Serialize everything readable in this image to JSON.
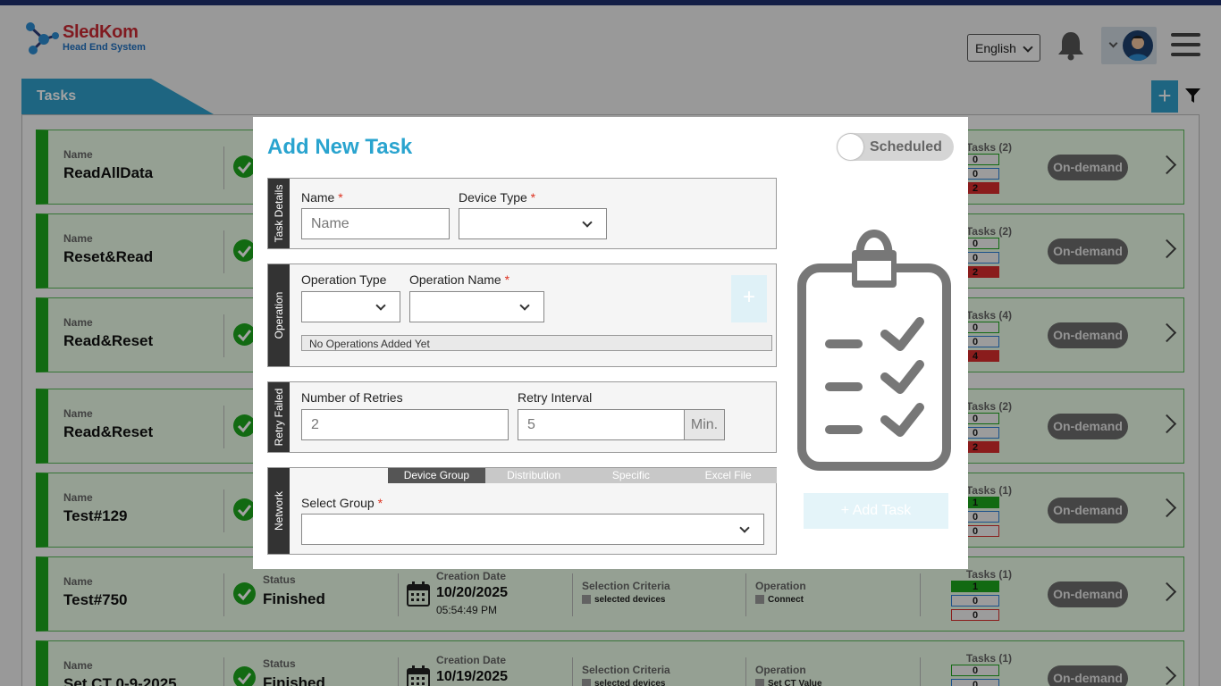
{
  "header": {
    "logo_title": "SledKom",
    "logo_subtitle": "Head End System",
    "language": "English"
  },
  "page": {
    "tab_title": "Tasks",
    "add_label": "+"
  },
  "labels": {
    "name": "Name",
    "status": "Status",
    "creation_date": "Creation Date",
    "selection_criteria": "Selection Criteria",
    "operation": "Operation"
  },
  "tasks": [
    {
      "name": "ReadAllData",
      "status": "",
      "date": "",
      "time": "",
      "selection": "",
      "operation": "",
      "tasks_label": "Tasks (2)",
      "ok": "0",
      "pending": "0",
      "failed": "2",
      "ok_fill": false,
      "fail_fill": true,
      "mode": "On-demand"
    },
    {
      "name": "Reset&Read",
      "status": "",
      "date": "",
      "time": "",
      "selection": "",
      "operation": "",
      "tasks_label": "Tasks (2)",
      "ok": "0",
      "pending": "0",
      "failed": "2",
      "ok_fill": false,
      "fail_fill": true,
      "mode": "On-demand"
    },
    {
      "name": "Read&Reset",
      "status": "",
      "date": "",
      "time": "",
      "selection": "",
      "operation": "",
      "tasks_label": "Tasks (4)",
      "ok": "0",
      "pending": "0",
      "failed": "4",
      "ok_fill": false,
      "fail_fill": true,
      "mode": "On-demand"
    },
    {
      "name": "Read&Reset",
      "status": "",
      "date": "",
      "time": "",
      "selection": "",
      "operation": "",
      "tasks_label": "Tasks (2)",
      "ok": "0",
      "pending": "0",
      "failed": "2",
      "ok_fill": false,
      "fail_fill": true,
      "mode": "On-demand"
    },
    {
      "name": "Test#129",
      "status": "",
      "date": "",
      "time": "",
      "selection": "",
      "operation": "",
      "tasks_label": "Tasks (1)",
      "ok": "1",
      "pending": "0",
      "failed": "0",
      "ok_fill": true,
      "fail_fill": false,
      "mode": "On-demand"
    },
    {
      "name": "Test#750",
      "status": "Finished",
      "date": "10/20/2025",
      "time": "05:54:49 PM",
      "selection": "selected devices",
      "operation": "Connect",
      "tasks_label": "Tasks (1)",
      "ok": "1",
      "pending": "0",
      "failed": "0",
      "ok_fill": true,
      "fail_fill": false,
      "mode": "On-demand"
    },
    {
      "name": "Set CT 0-9-2025",
      "status": "Finished",
      "date": "10/19/2025",
      "time": "",
      "selection": "selected devices",
      "operation": "Set CT Value",
      "tasks_label": "Tasks (1)",
      "ok": "0",
      "pending": "0",
      "failed": "",
      "ok_fill": false,
      "fail_fill": false,
      "mode": "On-demand"
    }
  ],
  "modal": {
    "title": "Add New Task",
    "scheduled_label": "Scheduled",
    "scheduled_on": false,
    "task_details": {
      "section_label": "Task Details",
      "name_label": "Name",
      "name_placeholder": "Name",
      "device_type_label": "Device Type",
      "device_type_value": ""
    },
    "operation": {
      "section_label": "Operation",
      "type_label": "Operation Type",
      "name_label": "Operation Name",
      "add_label": "+",
      "empty_text": "No Operations Added Yet"
    },
    "retry": {
      "section_label": "Retry Failed",
      "retries_label": "Number of Retries",
      "retries_value": "2",
      "interval_label": "Retry Interval",
      "interval_value": "5",
      "unit": "Min."
    },
    "network": {
      "section_label": "Network",
      "tabs": [
        "Device Group",
        "Distribution",
        "Specific",
        "Excel File"
      ],
      "active_tab": "Device Group",
      "select_group_label": "Select Group",
      "required_mark": "*"
    },
    "add_task_label": "+ Add Task"
  },
  "colors": {
    "accent": "#2aa4cf",
    "success": "#1da71d",
    "failed": "#d82d2d",
    "pending": "#2d7fd8",
    "header_bar": "#1f2f6e"
  }
}
